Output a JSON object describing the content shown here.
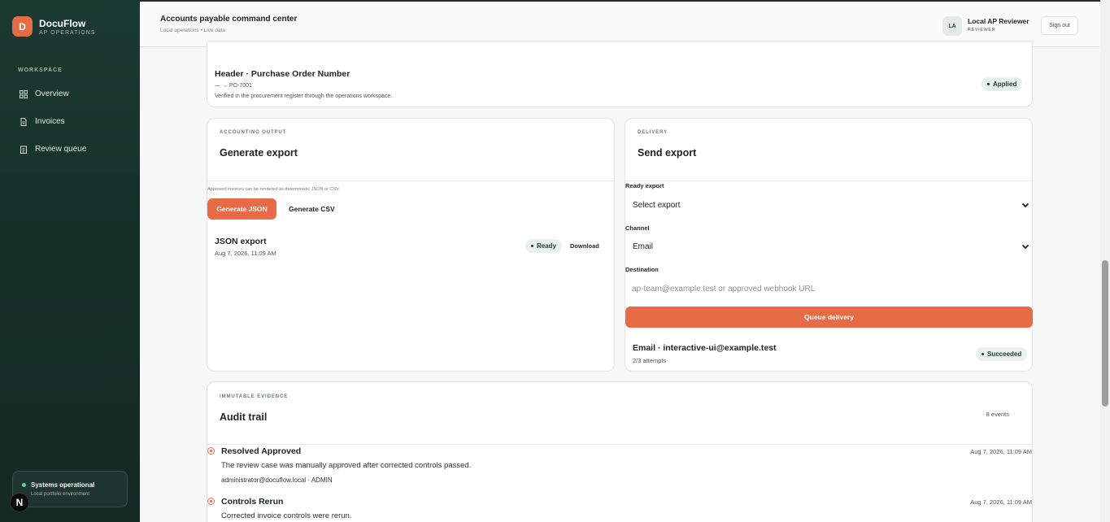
{
  "sidebar": {
    "logo_letter": "D",
    "brand_name": "DocuFlow",
    "brand_sub": "AP OPERATIONS",
    "section": "WORKSPACE",
    "items": [
      {
        "label": "Overview",
        "icon": "grid-icon"
      },
      {
        "label": "Invoices",
        "icon": "document-icon"
      },
      {
        "label": "Review queue",
        "icon": "clipboard-icon"
      }
    ],
    "status": {
      "title": "Systems operational",
      "subtitle": "Local portfolio environment",
      "color": "#5fd39a"
    },
    "next_badge": "N"
  },
  "header": {
    "title": "Accounts payable command center",
    "subtitle": "Local operations  •  Live data",
    "user_initials": "LA",
    "user_name": "Local AP Reviewer",
    "user_role": "REVIEWER",
    "signout_label": "Sign out"
  },
  "field_card": {
    "title": "Header · Purchase Order Number",
    "change": "— → PO-7001",
    "note": "Verified in the procurement register through the operations workspace.",
    "status": "Applied"
  },
  "export_card": {
    "eyebrow": "ACCOUNTING OUTPUT",
    "title": "Generate export",
    "hint": "Approved invoices can be rendered as deterministic JSON or CSV.",
    "json_button": "Generate JSON",
    "csv_button": "Generate CSV",
    "export_item": {
      "name": "JSON export",
      "date": "Aug 7, 2026, 11:09 AM",
      "status": "Ready",
      "action": "Download"
    }
  },
  "delivery_card": {
    "eyebrow": "DELIVERY",
    "title": "Send export",
    "ready_label": "Ready export",
    "ready_value": "Select export",
    "channel_label": "Channel",
    "channel_value": "Email",
    "destination_label": "Destination",
    "destination_placeholder": "ap-team@example.test or approved webhook URL",
    "queue_button": "Queue delivery",
    "delivery_item": {
      "title": "Email · interactive-ui@example.test",
      "attempts": "2/3 attempts",
      "status": "Succeeded"
    }
  },
  "audit_card": {
    "eyebrow": "IMMUTABLE EVIDENCE",
    "title": "Audit trail",
    "count": "8 events",
    "events": [
      {
        "title": "Resolved Approved",
        "description": "The review case was manually approved after corrected controls passed.",
        "actor": "administrator@docuflow.local · ADMIN",
        "time": "Aug 7, 2026, 11:09 AM"
      },
      {
        "title": "Controls Rerun",
        "description": "Corrected invoice controls were rerun.",
        "actor": "",
        "time": "Aug 7, 2026, 11:09 AM"
      }
    ]
  },
  "colors": {
    "accent": "#e96b45",
    "sidebar": "#1b3a31",
    "pill_bg": "#e9f1ec"
  }
}
